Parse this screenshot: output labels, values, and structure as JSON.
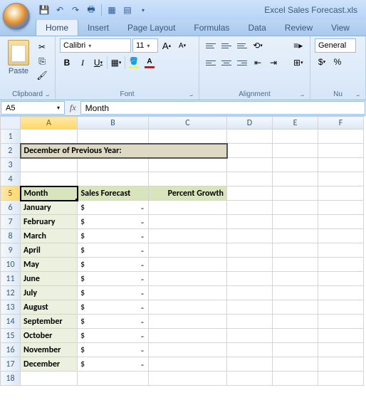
{
  "titlebar": {
    "title": "Excel Sales Forecast.xls"
  },
  "tabs": [
    "Home",
    "Insert",
    "Page Layout",
    "Formulas",
    "Data",
    "Review",
    "View"
  ],
  "active_tab": "Home",
  "ribbon": {
    "clipboard": {
      "paste": "Paste",
      "label": "Clipboard"
    },
    "font": {
      "name": "Calibri",
      "size": "11",
      "bold": "B",
      "italic": "I",
      "underline": "U",
      "grow": "A",
      "shrink": "A",
      "label": "Font"
    },
    "alignment": {
      "label": "Alignment"
    },
    "number": {
      "format": "General",
      "label": "Nu"
    }
  },
  "namebox": "A5",
  "formula": "Month",
  "columns": [
    "A",
    "B",
    "C",
    "D",
    "E",
    "F"
  ],
  "sheet": {
    "banner": "December of Previous Year:",
    "headers": {
      "month": "Month",
      "sales": "Sales Forecast",
      "growth": "Percent Growth"
    },
    "rows": [
      {
        "r": 6,
        "month": "January",
        "sales_sym": "$",
        "sales_val": "-"
      },
      {
        "r": 7,
        "month": "February",
        "sales_sym": "$",
        "sales_val": "-"
      },
      {
        "r": 8,
        "month": "March",
        "sales_sym": "$",
        "sales_val": "-"
      },
      {
        "r": 9,
        "month": "April",
        "sales_sym": "$",
        "sales_val": "-"
      },
      {
        "r": 10,
        "month": "May",
        "sales_sym": "$",
        "sales_val": "-"
      },
      {
        "r": 11,
        "month": "June",
        "sales_sym": "$",
        "sales_val": "-"
      },
      {
        "r": 12,
        "month": "July",
        "sales_sym": "$",
        "sales_val": "-"
      },
      {
        "r": 13,
        "month": "August",
        "sales_sym": "$",
        "sales_val": "-"
      },
      {
        "r": 14,
        "month": "September",
        "sales_sym": "$",
        "sales_val": "-"
      },
      {
        "r": 15,
        "month": "October",
        "sales_sym": "$",
        "sales_val": "-"
      },
      {
        "r": 16,
        "month": "November",
        "sales_sym": "$",
        "sales_val": "-"
      },
      {
        "r": 17,
        "month": "December",
        "sales_sym": "$",
        "sales_val": "-"
      }
    ]
  }
}
